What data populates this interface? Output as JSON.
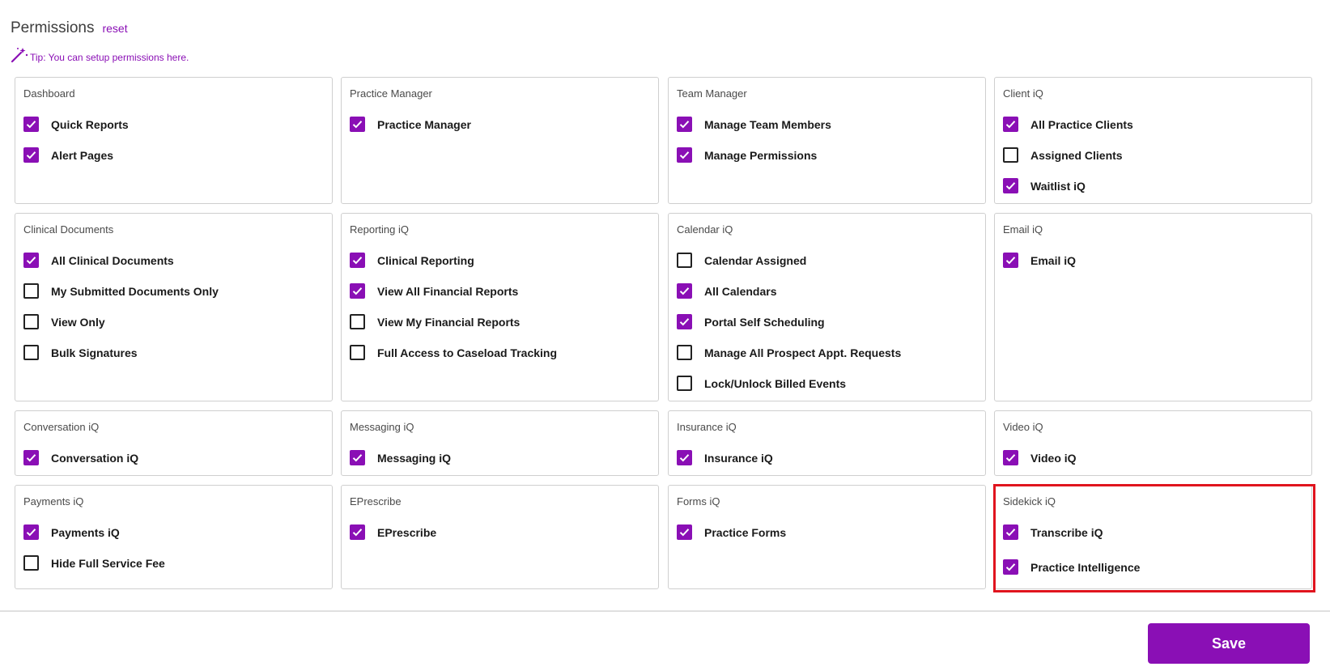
{
  "header": {
    "title": "Permissions",
    "reset_label": "reset"
  },
  "tip": {
    "text": "Tip: You can setup permissions here.",
    "icon": "magic-wand-icon"
  },
  "colors": {
    "accent": "#8a0fb5",
    "highlight": "#e0141e"
  },
  "panels": [
    {
      "title": "Dashboard",
      "items": [
        {
          "label": "Quick Reports",
          "checked": true
        },
        {
          "label": "Alert Pages",
          "checked": true
        }
      ]
    },
    {
      "title": "Practice Manager",
      "items": [
        {
          "label": "Practice Manager",
          "checked": true
        }
      ]
    },
    {
      "title": "Team Manager",
      "items": [
        {
          "label": "Manage Team Members",
          "checked": true
        },
        {
          "label": "Manage Permissions",
          "checked": true
        }
      ]
    },
    {
      "title": "Client iQ",
      "items": [
        {
          "label": "All Practice Clients",
          "checked": true
        },
        {
          "label": "Assigned Clients",
          "checked": false
        },
        {
          "label": "Waitlist iQ",
          "checked": true
        }
      ]
    },
    {
      "title": "Clinical Documents",
      "items": [
        {
          "label": "All Clinical Documents",
          "checked": true
        },
        {
          "label": "My Submitted Documents Only",
          "checked": false
        },
        {
          "label": "View Only",
          "checked": false
        },
        {
          "label": "Bulk Signatures",
          "checked": false
        }
      ]
    },
    {
      "title": "Reporting iQ",
      "items": [
        {
          "label": "Clinical Reporting",
          "checked": true
        },
        {
          "label": "View All Financial Reports",
          "checked": true
        },
        {
          "label": "View My Financial Reports",
          "checked": false
        },
        {
          "label": "Full Access to Caseload Tracking",
          "checked": false
        }
      ]
    },
    {
      "title": "Calendar iQ",
      "items": [
        {
          "label": "Calendar Assigned",
          "checked": false
        },
        {
          "label": "All Calendars",
          "checked": true
        },
        {
          "label": "Portal Self Scheduling",
          "checked": true
        },
        {
          "label": "Manage All Prospect Appt. Requests",
          "checked": false
        },
        {
          "label": "Lock/Unlock Billed Events",
          "checked": false
        }
      ]
    },
    {
      "title": "Email iQ",
      "items": [
        {
          "label": "Email iQ",
          "checked": true
        }
      ]
    },
    {
      "title": "Conversation iQ",
      "items": [
        {
          "label": "Conversation iQ",
          "checked": true
        }
      ]
    },
    {
      "title": "Messaging iQ",
      "items": [
        {
          "label": "Messaging iQ",
          "checked": true
        }
      ]
    },
    {
      "title": "Insurance iQ",
      "items": [
        {
          "label": "Insurance iQ",
          "checked": true
        }
      ]
    },
    {
      "title": "Video iQ",
      "items": [
        {
          "label": "Video iQ",
          "checked": true
        }
      ]
    },
    {
      "title": "Payments iQ",
      "items": [
        {
          "label": "Payments iQ",
          "checked": true
        },
        {
          "label": "Hide Full Service Fee",
          "checked": false
        }
      ]
    },
    {
      "title": "EPrescribe",
      "items": [
        {
          "label": "EPrescribe",
          "checked": true
        }
      ]
    },
    {
      "title": "Forms iQ",
      "items": [
        {
          "label": "Practice Forms",
          "checked": true
        }
      ]
    },
    {
      "title": "Sidekick iQ",
      "items": [
        {
          "label": "Transcribe iQ",
          "checked": true
        },
        {
          "label": "Practice Intelligence",
          "checked": true
        }
      ]
    }
  ],
  "footer": {
    "save_label": "Save"
  }
}
